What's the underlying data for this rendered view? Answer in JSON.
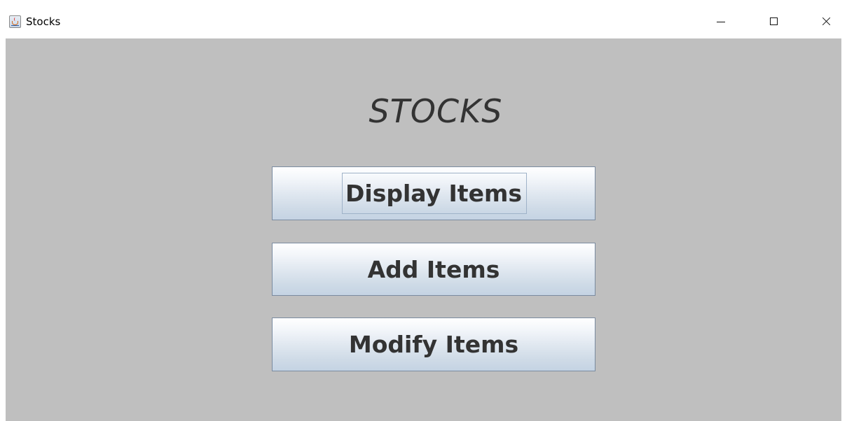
{
  "window": {
    "title": "Stocks",
    "app_icon": "java-cup-icon",
    "controls": {
      "minimize_icon": "minimize-icon",
      "maximize_icon": "maximize-icon",
      "close_icon": "close-icon"
    }
  },
  "main": {
    "heading": "STOCKS",
    "buttons": [
      {
        "label": "Display Items",
        "focused": true
      },
      {
        "label": "Add Items",
        "focused": false
      },
      {
        "label": "Modify Items",
        "focused": false
      }
    ]
  },
  "colors": {
    "content_background": "#bfbfbf",
    "text": "#333333",
    "button_border": "#7a8ba0"
  }
}
